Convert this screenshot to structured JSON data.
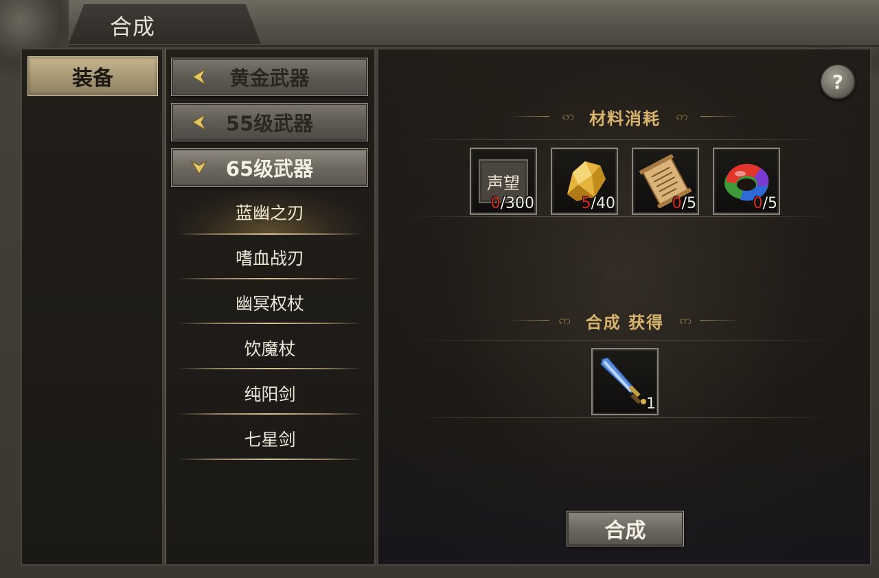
{
  "window": {
    "title": "合成"
  },
  "category": {
    "label": "装备"
  },
  "groups": [
    {
      "label": "黄金武器",
      "state": "collapsed"
    },
    {
      "label": "55级武器",
      "state": "collapsed"
    },
    {
      "label": "65级武器",
      "state": "expanded"
    }
  ],
  "items": [
    {
      "label": "蓝幽之刃",
      "selected": true
    },
    {
      "label": "嗜血战刃",
      "selected": false
    },
    {
      "label": "幽冥权杖",
      "selected": false
    },
    {
      "label": "饮魔杖",
      "selected": false
    },
    {
      "label": "纯阳剑",
      "selected": false
    },
    {
      "label": "七星剑",
      "selected": false
    }
  ],
  "materials_section": {
    "title": "材料消耗"
  },
  "materials": [
    {
      "icon": "reputation-token-icon",
      "icon_text": "声望",
      "have": "0",
      "need": "/300"
    },
    {
      "icon": "gold-ore-icon",
      "have": "5",
      "need": "/40"
    },
    {
      "icon": "scroll-icon",
      "have": "0",
      "need": "/5"
    },
    {
      "icon": "rainbow-gem-icon",
      "have": "0",
      "need": "/5"
    }
  ],
  "result_section": {
    "title": "合成 获得"
  },
  "result": {
    "icon": "blue-sword-icon",
    "count": "1"
  },
  "help": {
    "label": "?"
  },
  "actions": {
    "synthesize": "合成"
  },
  "colors": {
    "accent_gold": "#d8b46c",
    "insufficient_red": "#e02a1c"
  }
}
